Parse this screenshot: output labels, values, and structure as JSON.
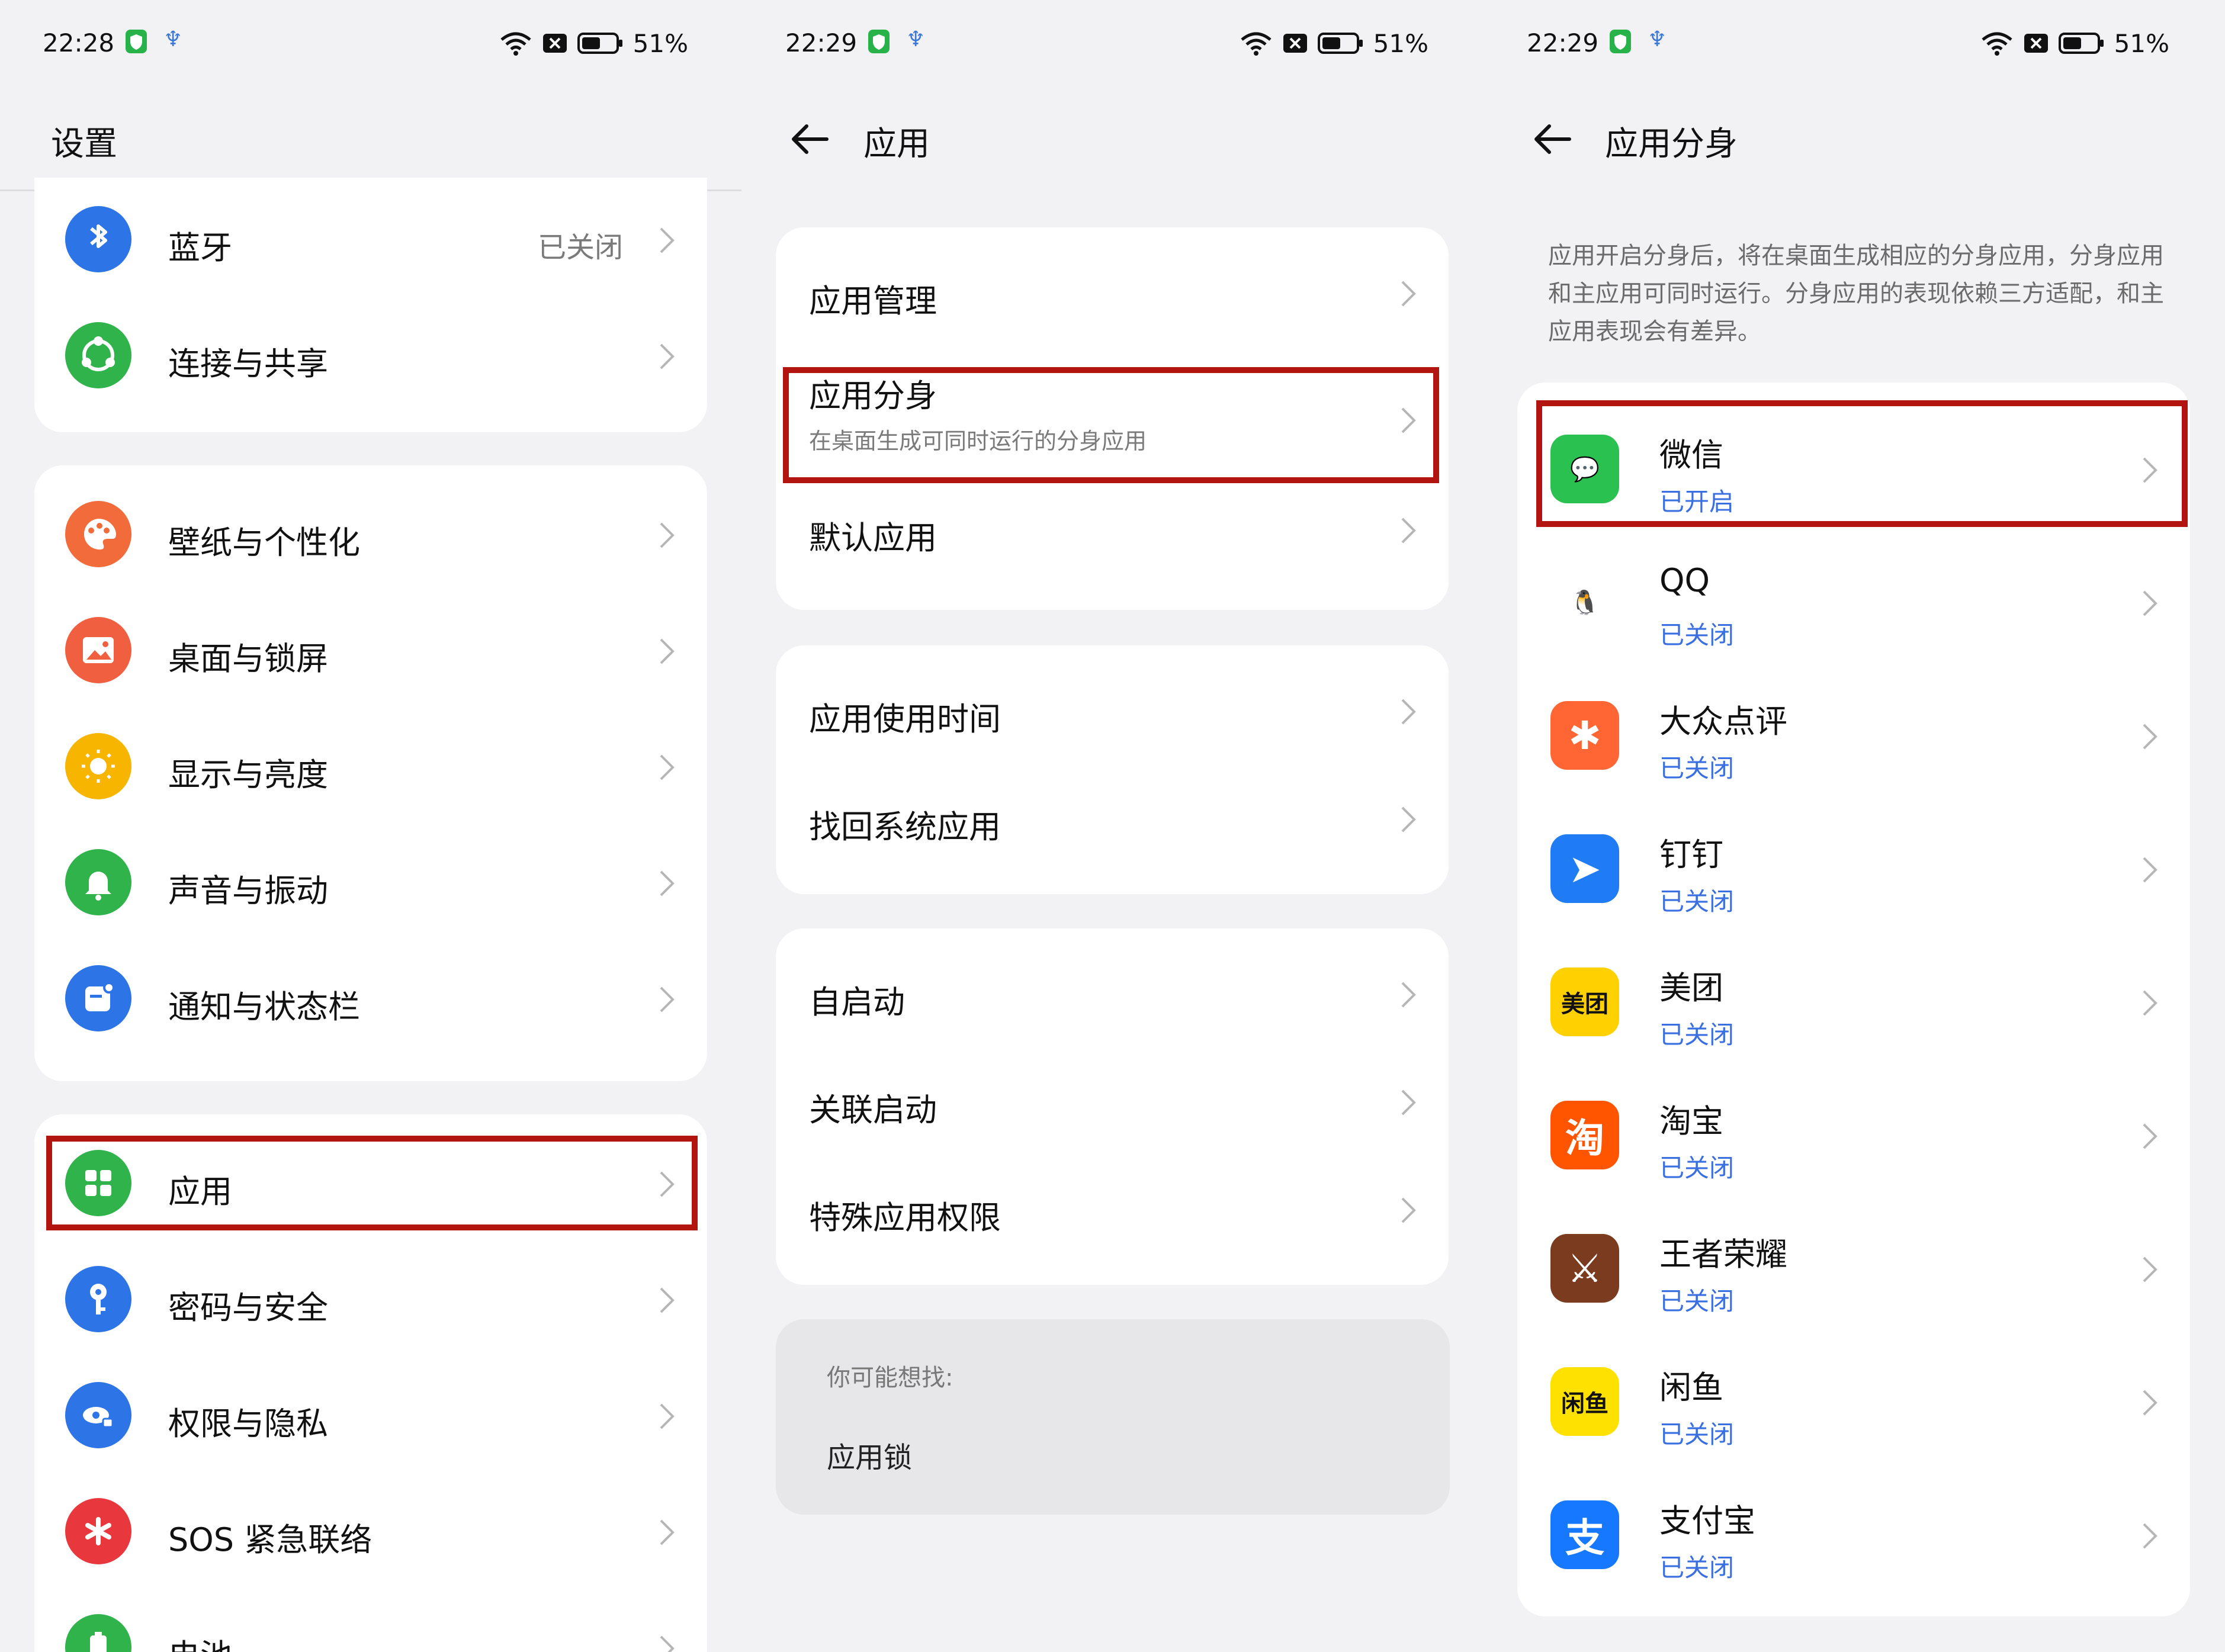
{
  "colors": {
    "highlight": "#b2140f",
    "status_blue": "#3a6fe2",
    "background": "#f2f2f4"
  },
  "status_bars": [
    {
      "time": "22:28",
      "battery": "51%"
    },
    {
      "time": "22:29",
      "battery": "51%"
    },
    {
      "time": "22:29",
      "battery": "51%"
    }
  ],
  "panel1": {
    "title": "设置",
    "group1": [
      {
        "label": "蓝牙",
        "value": "已关闭",
        "icon": "bluetooth-icon",
        "color": "#2d74e6"
      },
      {
        "label": "连接与共享",
        "icon": "share-connection-icon",
        "color": "#2fb34a"
      }
    ],
    "group2": [
      {
        "label": "壁纸与个性化",
        "icon": "palette-icon",
        "color": "#f26b3a"
      },
      {
        "label": "桌面与锁屏",
        "icon": "image-icon",
        "color": "#f06040"
      },
      {
        "label": "显示与亮度",
        "icon": "sun-icon",
        "color": "#f7b500"
      },
      {
        "label": "声音与振动",
        "icon": "bell-icon",
        "color": "#2fb34a"
      },
      {
        "label": "通知与状态栏",
        "icon": "notification-icon",
        "color": "#2d74e6"
      }
    ],
    "group3": [
      {
        "label": "应用",
        "icon": "apps-grid-icon",
        "color": "#2fb34a"
      },
      {
        "label": "密码与安全",
        "icon": "key-icon",
        "color": "#2d74e6"
      },
      {
        "label": "权限与隐私",
        "icon": "privacy-icon",
        "color": "#2d74e6"
      },
      {
        "label": "SOS 紧急联络",
        "icon": "sos-icon",
        "color": "#e8383d"
      },
      {
        "label": "电池",
        "icon": "battery-icon",
        "color": "#2fb34a"
      }
    ]
  },
  "panel2": {
    "title": "应用",
    "group1": [
      {
        "label": "应用管理"
      },
      {
        "label": "应用分身",
        "sub": "在桌面生成可同时运行的分身应用"
      },
      {
        "label": "默认应用"
      }
    ],
    "group2": [
      {
        "label": "应用使用时间"
      },
      {
        "label": "找回系统应用"
      }
    ],
    "group3": [
      {
        "label": "自启动"
      },
      {
        "label": "关联启动"
      },
      {
        "label": "特殊应用权限"
      }
    ],
    "suggest": {
      "heading": "你可能想找:",
      "item": "应用锁"
    }
  },
  "panel3": {
    "title": "应用分身",
    "description": "应用开启分身后，将在桌面生成相应的分身应用，分身应用和主应用可同时运行。分身应用的表现依赖三方适配，和主应用表现会有差异。",
    "apps": [
      {
        "name": "微信",
        "status": "已开启",
        "icon": "wechat-icon",
        "color": "#2ac150",
        "glyph": "💬"
      },
      {
        "name": "QQ",
        "status": "已关闭",
        "icon": "qq-icon",
        "color": "#ffffff",
        "glyph": "🐧"
      },
      {
        "name": "大众点评",
        "status": "已关闭",
        "icon": "dianping-icon",
        "color": "#ff6633",
        "glyph": "✱"
      },
      {
        "name": "钉钉",
        "status": "已关闭",
        "icon": "dingtalk-icon",
        "color": "#1f7cf5",
        "glyph": "➤"
      },
      {
        "name": "美团",
        "status": "已关闭",
        "icon": "meituan-icon",
        "color": "#ffd100",
        "glyph": "美团"
      },
      {
        "name": "淘宝",
        "status": "已关闭",
        "icon": "taobao-icon",
        "color": "#ff5500",
        "glyph": "淘"
      },
      {
        "name": "王者荣耀",
        "status": "已关闭",
        "icon": "honor-of-kings-icon",
        "color": "#7a3b1e",
        "glyph": "⚔"
      },
      {
        "name": "闲鱼",
        "status": "已关闭",
        "icon": "xianyu-icon",
        "color": "#ffe100",
        "glyph": "闲鱼"
      },
      {
        "name": "支付宝",
        "status": "已关闭",
        "icon": "alipay-icon",
        "color": "#1677ff",
        "glyph": "支"
      }
    ]
  }
}
